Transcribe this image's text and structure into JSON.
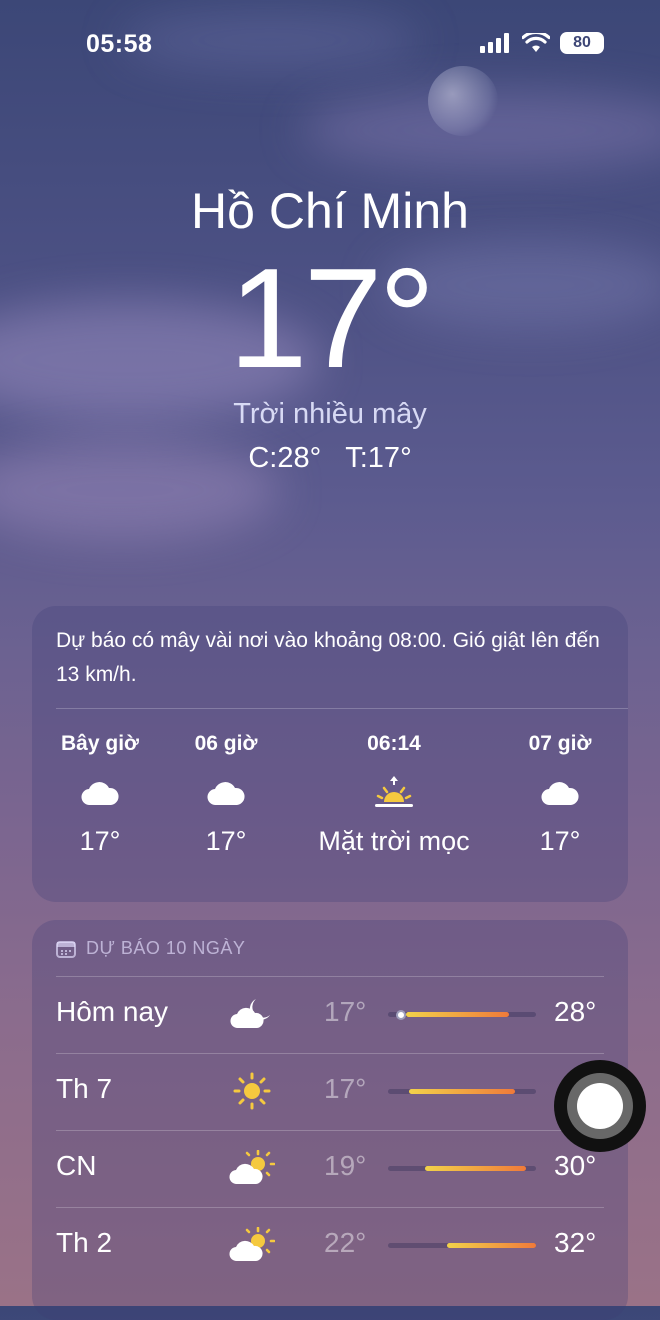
{
  "status": {
    "time": "05:58",
    "battery": "80"
  },
  "location": {
    "city": "Hồ Chí Minh",
    "temperature": "17°",
    "condition": "Trời nhiều mây",
    "high": "C:28°",
    "low": "T:17°"
  },
  "hourly": {
    "summary": "Dự báo có mây vài nơi vào khoảng 08:00. Gió giật lên đến 13 km/h.",
    "items": [
      {
        "label": "Bây giờ",
        "icon": "cloud-icon",
        "value": "17°"
      },
      {
        "label": "06 giờ",
        "icon": "cloud-icon",
        "value": "17°"
      },
      {
        "label": "06:14",
        "icon": "sunrise-icon",
        "value": "Mặt trời mọc"
      },
      {
        "label": "07 giờ",
        "icon": "cloud-icon",
        "value": "17°"
      }
    ]
  },
  "forecast": {
    "header": "DỰ BÁO 10 NGÀY",
    "days": [
      {
        "day": "Hôm nay",
        "icon": "moon-cloud-icon",
        "low": "17°",
        "high": "28°",
        "range_start": 0.12,
        "range_end": 0.82,
        "current": 0.12
      },
      {
        "day": "Th 7",
        "icon": "sun-icon",
        "low": "17°",
        "high": "",
        "range_start": 0.14,
        "range_end": 0.86
      },
      {
        "day": "CN",
        "icon": "sun-cloud-icon",
        "low": "19°",
        "high": "30°",
        "range_start": 0.25,
        "range_end": 0.93
      },
      {
        "day": "Th 2",
        "icon": "sun-cloud-icon",
        "low": "22°",
        "high": "32°",
        "range_start": 0.4,
        "range_end": 1.0
      }
    ]
  },
  "colors": {
    "bar_cool": "#f2d24a",
    "bar_warm": "#f07a3a"
  }
}
